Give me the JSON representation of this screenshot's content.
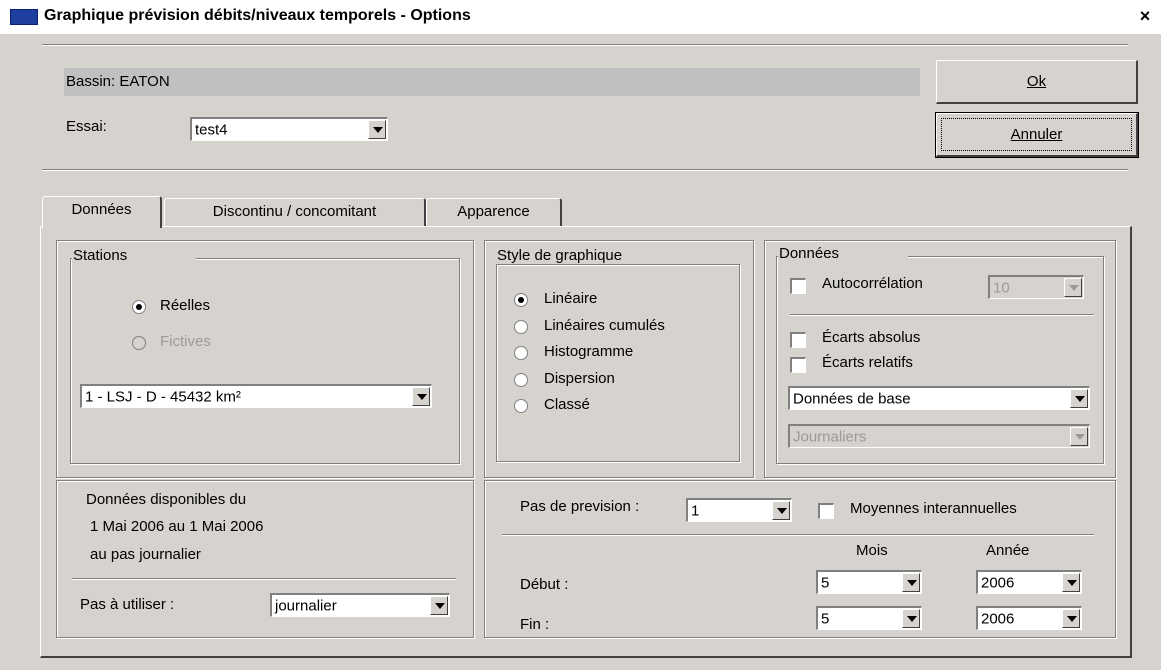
{
  "window": {
    "title": "Graphique prévision débits/niveaux temporels - Options",
    "close_label": "×"
  },
  "header": {
    "bassin": "Bassin: EATON",
    "essai_label": "Essai:",
    "essai_value": "test4"
  },
  "buttons": {
    "ok": "Ok",
    "cancel": "Annuler"
  },
  "tabs": [
    {
      "label": "Données"
    },
    {
      "label": "Discontinu / concomitant"
    },
    {
      "label": "Apparence"
    }
  ],
  "stations": {
    "title": "Stations",
    "reelles": "Réelles",
    "fictives": "Fictives",
    "station_value": "1 - LSJ - D - 45432 km²"
  },
  "style": {
    "title": "Style de graphique",
    "options": [
      "Linéaire",
      "Linéaires cumulés",
      "Histogramme",
      "Dispersion",
      "Classé"
    ]
  },
  "donnees": {
    "title": "Données",
    "autocorrelation": "Autocorrélation",
    "autocorrelation_value": "10",
    "ecarts_absolus": "Écarts absolus",
    "ecarts_relatifs": "Écarts relatifs",
    "base_value": "Données de base",
    "period_value": "Journaliers"
  },
  "disponibles": {
    "line1": "Données disponibles du",
    "line2": "1 Mai 2006 au 1 Mai 2006",
    "line3": "au pas journalier",
    "pas_label": "Pas à utiliser :",
    "pas_value": "journalier"
  },
  "prevision": {
    "pas_label": "Pas de prevision :",
    "pas_value": "1",
    "moyennes": "Moyennes interannuelles",
    "mois_header": "Mois",
    "annee_header": "Année",
    "debut_label": "Début :",
    "fin_label": "Fin :",
    "debut_mois": "5",
    "debut_annee": "2006",
    "fin_mois": "5",
    "fin_annee": "2006"
  },
  "colors": {
    "face": "#d6d3ce",
    "title_icon": "#1f3fa0",
    "disabled_text": "#9a9a9a"
  }
}
